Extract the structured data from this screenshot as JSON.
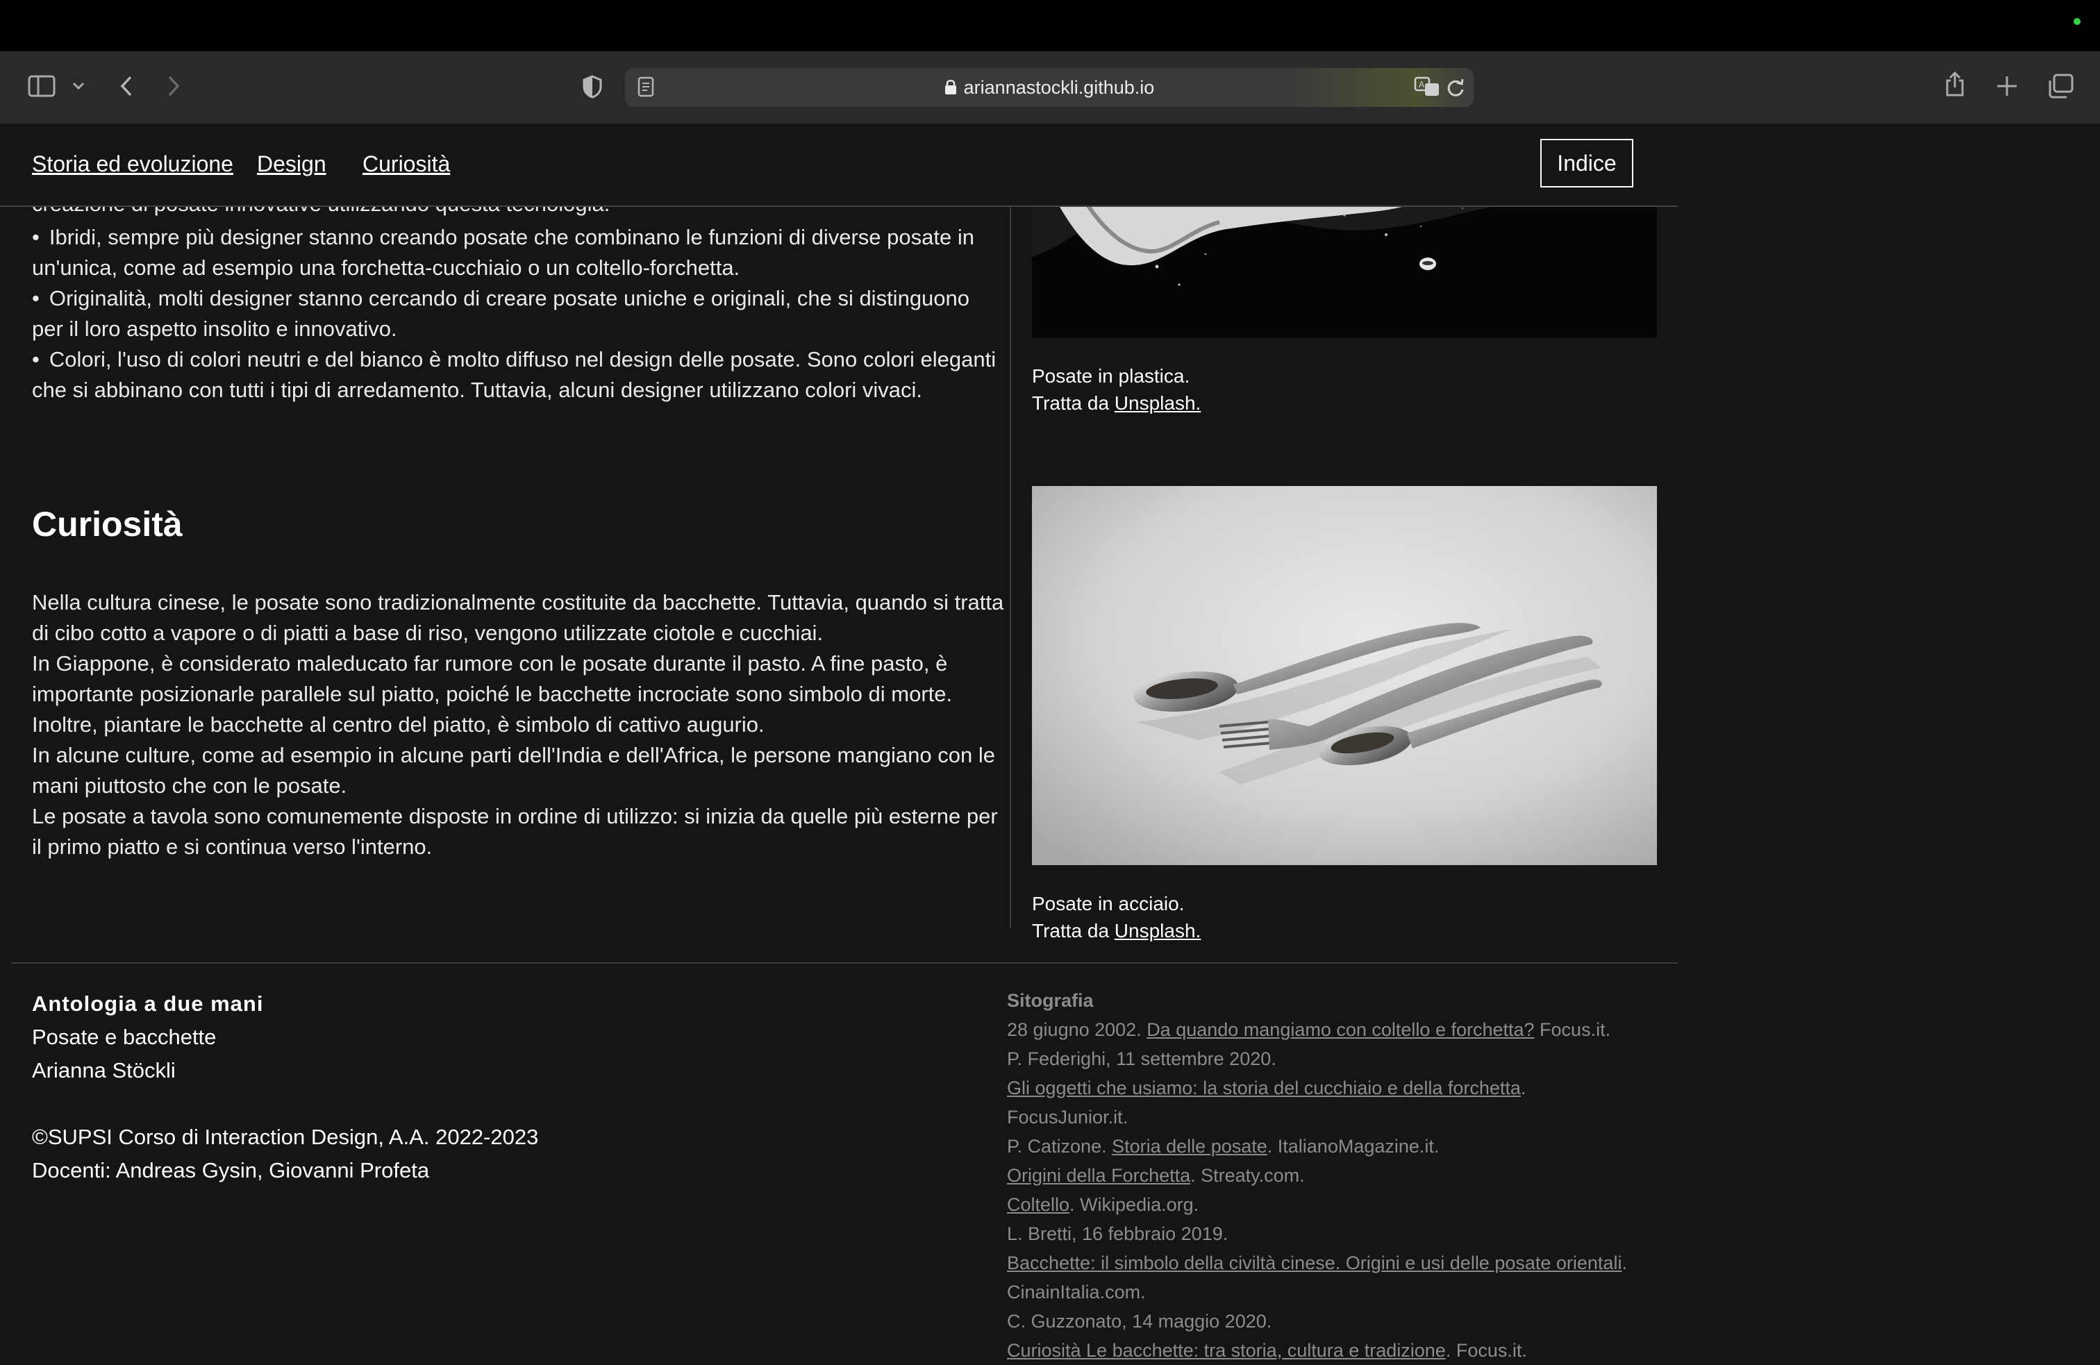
{
  "browser": {
    "url": "ariannastockli.github.io"
  },
  "nav": {
    "links": [
      "Storia ed evoluzione",
      "Design",
      "Curiosità"
    ],
    "index_button": "Indice"
  },
  "design_section": {
    "partial_line": "creazione di posate innovative utilizzando questa tecnologia.",
    "bullets": [
      "Ibridi, sempre più designer stanno creando posate che combinano le funzioni di diverse posate in un'unica, come ad esempio una forchetta-cucchiaio o un coltello-forchetta.",
      "Originalità, molti designer stanno cercando di creare posate uniche e originali, che si distinguono per il loro aspetto insolito e innovativo.",
      "Colori, l'uso di colori neutri e del bianco è molto diffuso nel design delle posate. Sono colori eleganti che si abbinano con tutti i tipi di arredamento. Tuttavia, alcuni designer utilizzano colori vivaci."
    ]
  },
  "curiosita_section": {
    "heading": "Curiosità",
    "paragraphs": [
      "Nella cultura cinese, le posate sono tradizionalmente costituite da bacchette. Tuttavia, quando si tratta di cibo cotto a vapore o di piatti a base di riso, vengono utilizzate ciotole e cucchiai.",
      "In Giappone, è considerato maleducato far rumore con le posate durante il pasto. A fine pasto, è importante posizionarle parallele sul piatto, poiché le bacchette incrociate sono simbolo di morte. Inoltre, piantare le bacchette al centro del piatto, è simbolo di cattivo augurio.",
      "In alcune culture, come ad esempio in alcune parti dell'India e dell'Africa, le persone mangiano con le mani piuttosto che con le posate.",
      "Le posate a tavola sono comunemente disposte in ordine di utilizzo: si inizia da quelle più esterne per il primo piatto e si continua verso l'interno."
    ]
  },
  "images": [
    {
      "caption": "Posate in plastica.",
      "source_prefix": "Tratta da ",
      "source_link": "Unsplash."
    },
    {
      "caption": "Posate in acciaio.",
      "source_prefix": "Tratta da ",
      "source_link": "Unsplash."
    }
  ],
  "footer": {
    "title": "Antologia a due mani",
    "subtitle": "Posate e bacchette",
    "author": "Arianna Stöckli",
    "copyright": "©SUPSI Corso di Interaction Design, A.A. 2022-2023",
    "teachers": "Docenti: Andreas Gysin, Giovanni Profeta",
    "sitografia_title": "Sitografia",
    "sources": [
      {
        "prefix": "28 giugno 2002. ",
        "link": "Da quando mangiamo con coltello e forchetta?",
        "suffix": " Focus.it."
      },
      {
        "prefix": "P. Federighi, 11 settembre 2020.",
        "link": "",
        "suffix": ""
      },
      {
        "prefix": "",
        "link": "Gli oggetti che usiamo: la storia del cucchiaio e della forchetta",
        "suffix": "."
      },
      {
        "prefix": "FocusJunior.it.",
        "link": "",
        "suffix": ""
      },
      {
        "prefix": "P. Catizone. ",
        "link": "Storia delle posate",
        "suffix": ". ItalianoMagazine.it."
      },
      {
        "prefix": "",
        "link": "Origini della Forchetta",
        "suffix": ". Streaty.com."
      },
      {
        "prefix": "",
        "link": "Coltello",
        "suffix": ". Wikipedia.org."
      },
      {
        "prefix": "L. Bretti, 16 febbraio 2019.",
        "link": "",
        "suffix": ""
      },
      {
        "prefix": "",
        "link": "Bacchette: il simbolo della civiltà cinese. Origini e usi delle posate orientali",
        "suffix": "."
      },
      {
        "prefix": "CinainItalia.com.",
        "link": "",
        "suffix": ""
      },
      {
        "prefix": "C. Guzzonato, 14 maggio 2020.",
        "link": "",
        "suffix": ""
      },
      {
        "prefix": "",
        "link": "Curiosità Le bacchette: tra storia, cultura e tradizione",
        "suffix": ". Focus.it."
      }
    ]
  }
}
